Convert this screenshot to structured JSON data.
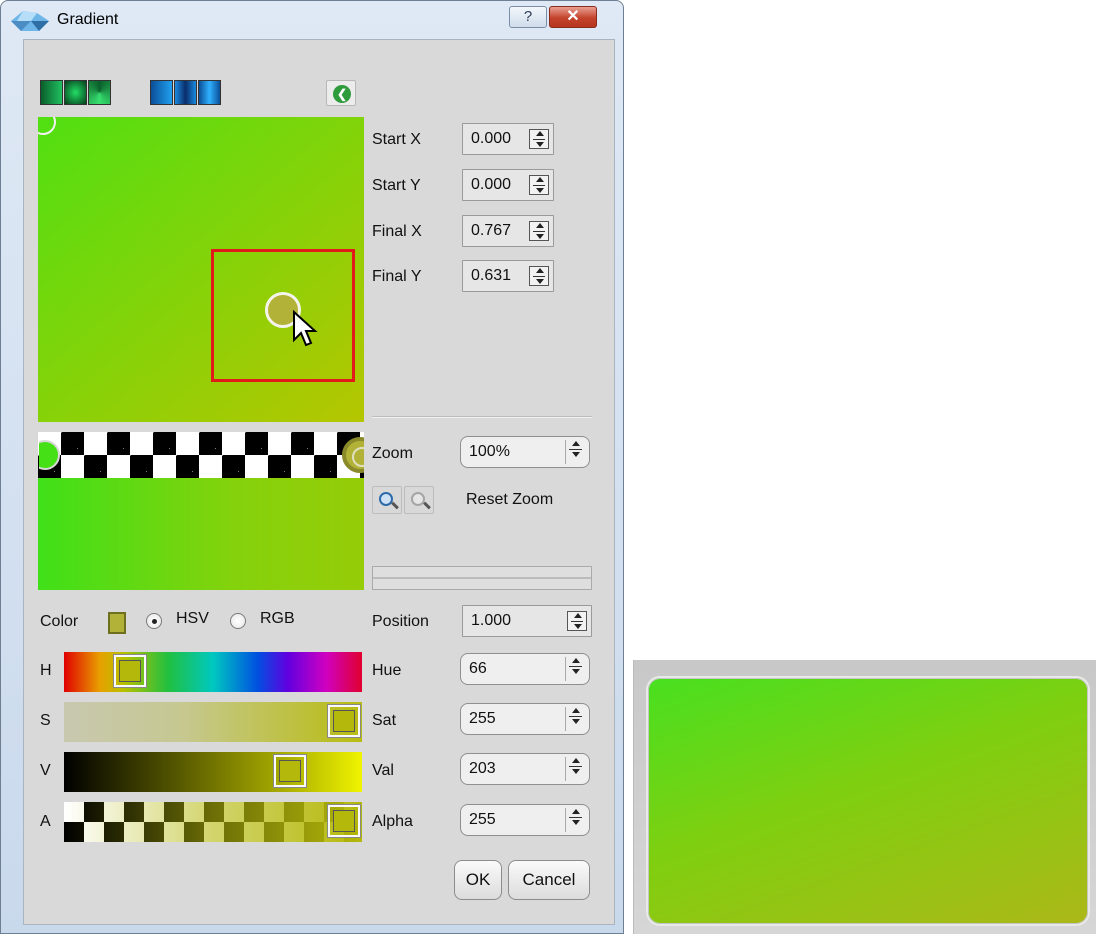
{
  "window": {
    "title": "Gradient",
    "help_label": "?",
    "close_label": "✕"
  },
  "presets": [
    {
      "name": "linear-green",
      "color": "#0d7a36"
    },
    {
      "name": "radial-green",
      "color": "#14a243"
    },
    {
      "name": "conical-green",
      "color": "#0b5d2b"
    },
    {
      "name": "linear-blue",
      "color": "#0f79c8"
    },
    {
      "name": "radial-blue",
      "color": "#0a4f98"
    },
    {
      "name": "conical-blue",
      "color": "#1673c3"
    }
  ],
  "coords": {
    "start_x_label": "Start X",
    "start_x": "0.000",
    "start_y_label": "Start Y",
    "start_y": "0.000",
    "final_x_label": "Final X",
    "final_x": "0.767",
    "final_y_label": "Final Y",
    "final_y": "0.631"
  },
  "zoom": {
    "label": "Zoom",
    "value": "100%",
    "reset_label": "Reset Zoom"
  },
  "color_panel": {
    "color_label": "Color",
    "mode_hsv": "HSV",
    "mode_rgb": "RGB",
    "selected_mode": "HSV",
    "swatch_color": "#b2b238",
    "h_label": "H",
    "s_label": "S",
    "v_label": "V",
    "a_label": "A"
  },
  "stop": {
    "position_label": "Position",
    "position": "1.000",
    "hue_label": "Hue",
    "hue": "66",
    "sat_label": "Sat",
    "sat": "255",
    "val_label": "Val",
    "val": "203",
    "alpha_label": "Alpha",
    "alpha": "255"
  },
  "buttons": {
    "ok": "OK",
    "cancel": "Cancel"
  }
}
